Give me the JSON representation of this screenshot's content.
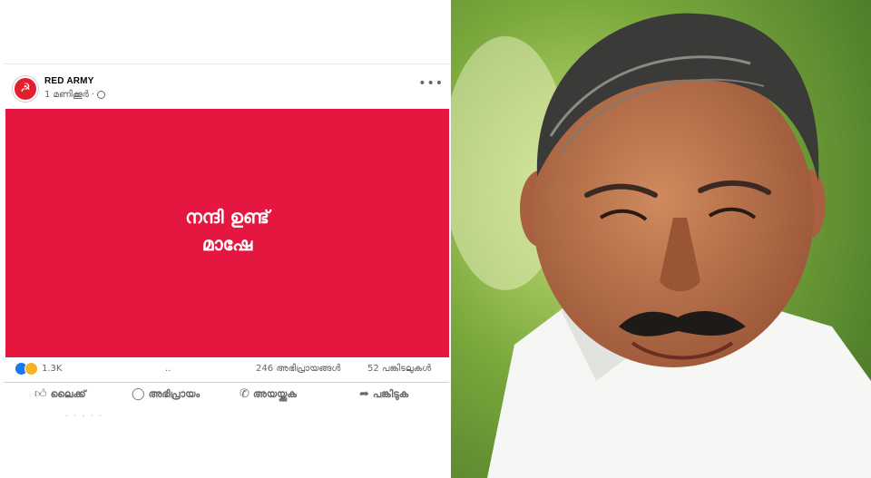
{
  "post": {
    "page_name": "RED ARMY",
    "timestamp": "1 മണിക്കൂർ",
    "more": "•••",
    "avatar_icon": "hammer-sickle-icon",
    "image_text_line1": "നന്ദി ഉണ്ട്",
    "image_text_line2": "മാഷേ",
    "image_bg": "#e5163f",
    "reaction_count": "1.3K",
    "comments": "246 അഭിപ്രായങ്ങൾ",
    "shares": "52 പങ്കിടലുകൾ",
    "actions": {
      "like": "ലൈക്ക്",
      "comment": "അഭിപ്രായം",
      "send": "അയയ്ക്കുക",
      "share": "പങ്കിടുക"
    }
  },
  "photo": {
    "subject": "smiling-man-portrait",
    "colors": {
      "background": "#7aa83c",
      "skin": "#b86f4a",
      "hair": "#3a3a38",
      "shirt": "#f6f6f4"
    }
  }
}
